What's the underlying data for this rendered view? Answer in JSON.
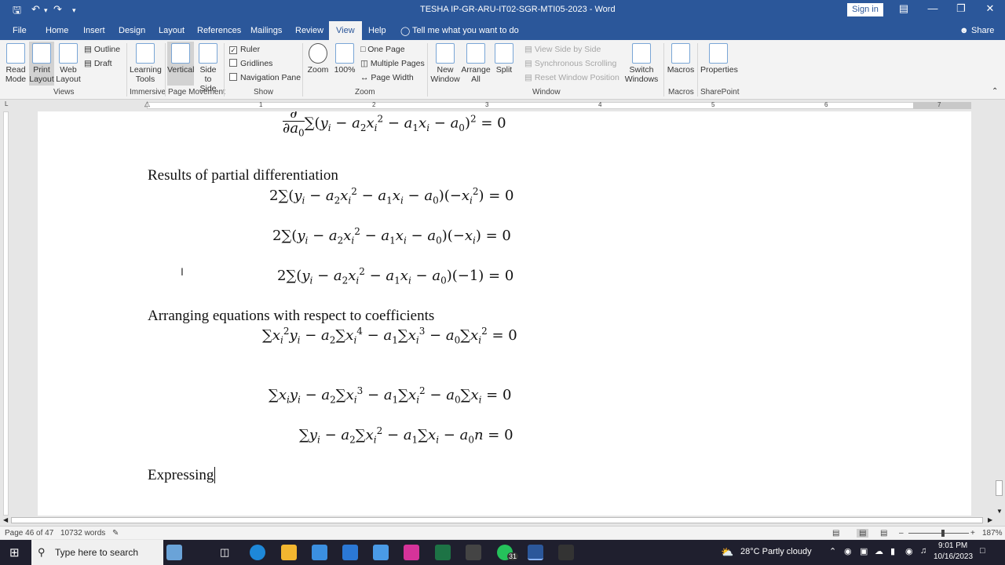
{
  "titlebar": {
    "title": "TESHA IP-GR-ARU-IT02-SGR-MTI05-2023  -  Word",
    "signin": "Sign in"
  },
  "tabs": [
    "File",
    "Home",
    "Insert",
    "Design",
    "Layout",
    "References",
    "Mailings",
    "Review",
    "View",
    "Help"
  ],
  "tell_me": "Tell me what you want to do",
  "share": "Share",
  "ribbon": {
    "views": {
      "read_mode": "Read Mode",
      "print_layout": "Print Layout",
      "web_layout": "Web Layout",
      "outline": "Outline",
      "draft": "Draft",
      "label": "Views"
    },
    "immersive": {
      "learning_tools": "Learning Tools",
      "label": "Immersive"
    },
    "page_movement": {
      "vertical": "Vertical",
      "side_to_side": "Side to Side",
      "label": "Page Movement"
    },
    "show": {
      "ruler": "Ruler",
      "gridlines": "Gridlines",
      "navigation_pane": "Navigation Pane",
      "label": "Show"
    },
    "zoom": {
      "zoom": "Zoom",
      "zoom100": "100%",
      "one_page": "One Page",
      "multiple_pages": "Multiple Pages",
      "page_width": "Page Width",
      "label": "Zoom"
    },
    "window": {
      "new_window": "New Window",
      "arrange_all": "Arrange All",
      "split": "Split",
      "view_side_by_side": "View Side by Side",
      "sync_scrolling": "Synchronous Scrolling",
      "reset_window": "Reset Window Position",
      "switch_windows": "Switch Windows",
      "label": "Window"
    },
    "macros": {
      "macros": "Macros",
      "label": "Macros"
    },
    "sharepoint": {
      "properties": "Properties",
      "label": "SharePoint"
    }
  },
  "ruler": {
    "numbers": [
      "1",
      "2",
      "3",
      "4",
      "5",
      "6",
      "7"
    ]
  },
  "document": {
    "heading1": "Results of partial differentiation",
    "heading2": "Arranging equations with respect to coefficients",
    "heading3": "Expressing"
  },
  "status": {
    "page": "Page 46 of 47",
    "words": "10732 words",
    "zoom": "187%"
  },
  "taskbar": {
    "search": "Type here to search",
    "weather": "28°C  Partly cloudy",
    "time": "9:01 PM",
    "date": "10/16/2023",
    "badge": "31"
  }
}
